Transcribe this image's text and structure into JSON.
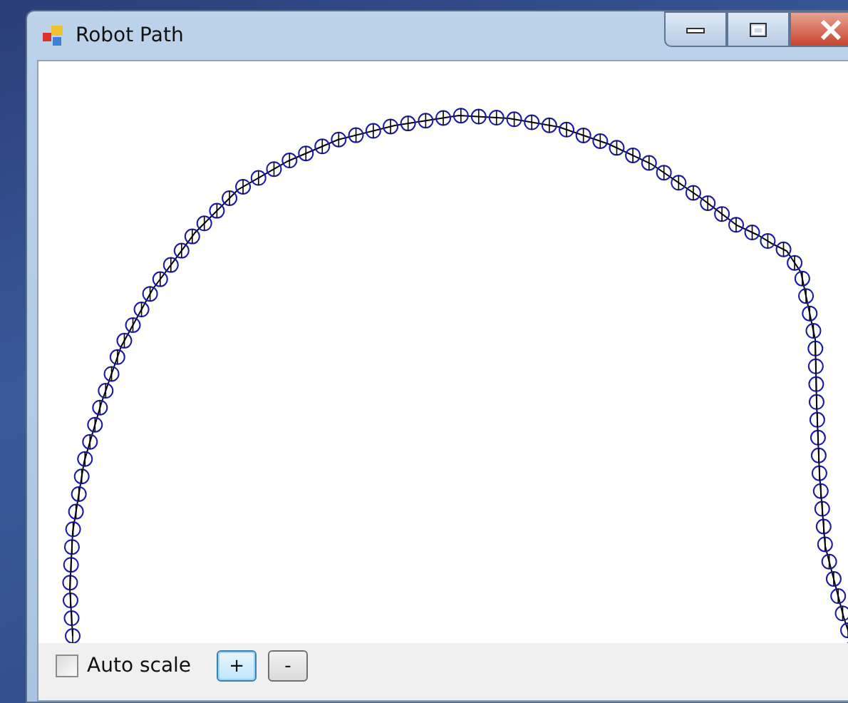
{
  "window": {
    "title": "Robot Path"
  },
  "auto_scale": {
    "label": "Auto scale",
    "checked": false
  },
  "buttons": [
    {
      "label": "+",
      "focused": true
    },
    {
      "label": "-",
      "focused": false
    }
  ]
}
